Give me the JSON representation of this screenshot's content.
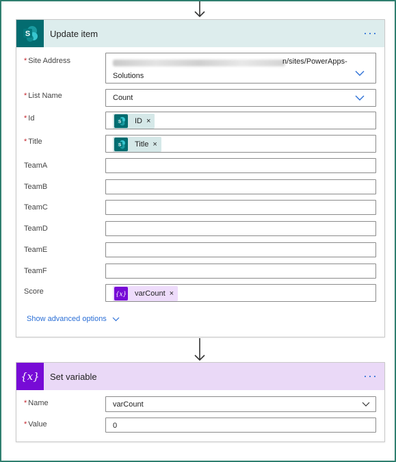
{
  "update_item": {
    "title": "Update item",
    "more_label": "···",
    "fields": {
      "site_address": {
        "label": "Site Address",
        "value_suffix_line1": "n/sites/PowerApps-",
        "value_line2": "Solutions"
      },
      "list_name": {
        "label": "List Name",
        "value": "Count"
      },
      "id": {
        "label": "Id",
        "token": "ID"
      },
      "title": {
        "label": "Title",
        "token": "Title"
      },
      "team_a": {
        "label": "TeamA",
        "value": ""
      },
      "team_b": {
        "label": "TeamB",
        "value": ""
      },
      "team_c": {
        "label": "TeamC",
        "value": ""
      },
      "team_d": {
        "label": "TeamD",
        "value": ""
      },
      "team_e": {
        "label": "TeamE",
        "value": ""
      },
      "team_f": {
        "label": "TeamF",
        "value": ""
      },
      "score": {
        "label": "Score",
        "token": "varCount"
      }
    },
    "advanced_label": "Show advanced options",
    "required_mark": "*",
    "token_remove": "×"
  },
  "set_variable": {
    "title": "Set variable",
    "more_label": "···",
    "fields": {
      "name": {
        "label": "Name",
        "value": "varCount"
      },
      "value": {
        "label": "Value",
        "value": "0"
      }
    },
    "required_mark": "*"
  },
  "colors": {
    "sharepoint_teal": "#036c70",
    "variable_purple": "#770bd6",
    "update_header_bg": "#ddeded",
    "variable_header_bg": "#ead9f7",
    "token_sp_bg": "#d5e8e8",
    "token_var_bg": "#eedcfb",
    "link_blue": "#2b6fd6",
    "required_red": "#c4262e"
  },
  "icons": {
    "sharepoint": "sharepoint-icon",
    "variable": "variable-icon",
    "arrow": "arrow-down-icon",
    "chevron": "chevron-down-icon"
  }
}
